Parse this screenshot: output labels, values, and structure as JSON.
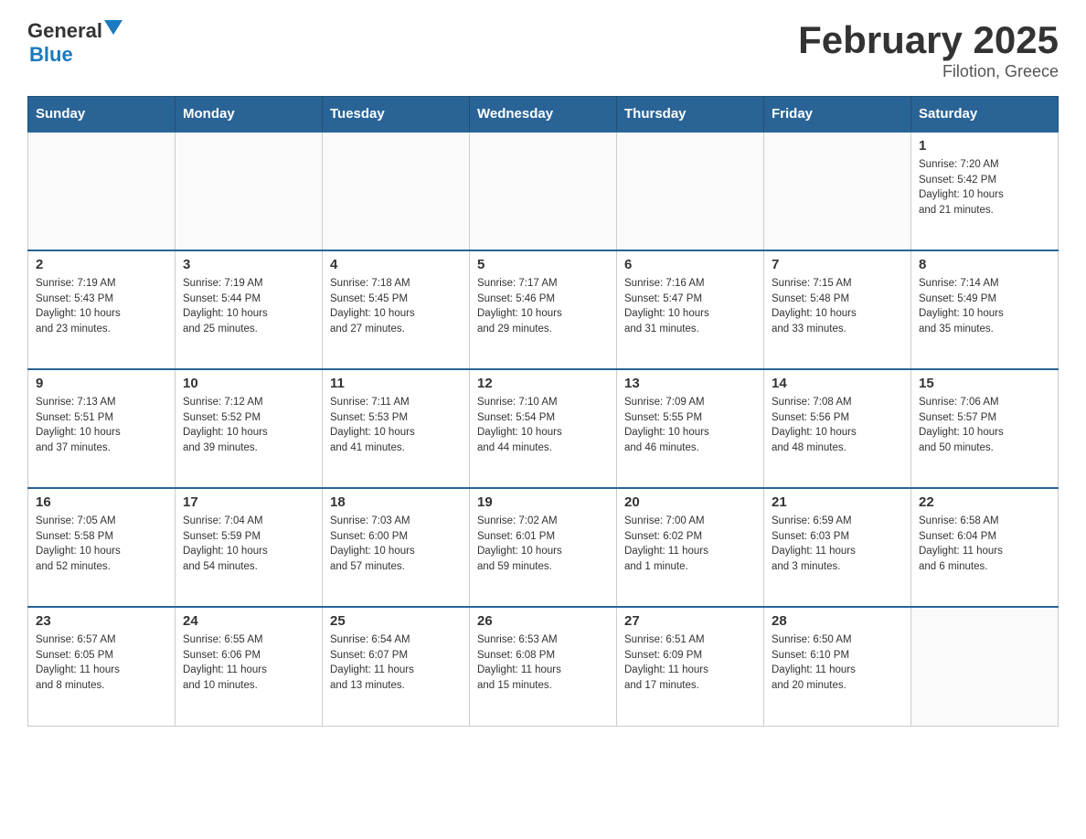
{
  "header": {
    "logo": {
      "general": "General",
      "blue": "Blue"
    },
    "title": "February 2025",
    "subtitle": "Filotion, Greece"
  },
  "calendar": {
    "headers": [
      "Sunday",
      "Monday",
      "Tuesday",
      "Wednesday",
      "Thursday",
      "Friday",
      "Saturday"
    ],
    "weeks": [
      [
        {
          "day": "",
          "info": ""
        },
        {
          "day": "",
          "info": ""
        },
        {
          "day": "",
          "info": ""
        },
        {
          "day": "",
          "info": ""
        },
        {
          "day": "",
          "info": ""
        },
        {
          "day": "",
          "info": ""
        },
        {
          "day": "1",
          "info": "Sunrise: 7:20 AM\nSunset: 5:42 PM\nDaylight: 10 hours\nand 21 minutes."
        }
      ],
      [
        {
          "day": "2",
          "info": "Sunrise: 7:19 AM\nSunset: 5:43 PM\nDaylight: 10 hours\nand 23 minutes."
        },
        {
          "day": "3",
          "info": "Sunrise: 7:19 AM\nSunset: 5:44 PM\nDaylight: 10 hours\nand 25 minutes."
        },
        {
          "day": "4",
          "info": "Sunrise: 7:18 AM\nSunset: 5:45 PM\nDaylight: 10 hours\nand 27 minutes."
        },
        {
          "day": "5",
          "info": "Sunrise: 7:17 AM\nSunset: 5:46 PM\nDaylight: 10 hours\nand 29 minutes."
        },
        {
          "day": "6",
          "info": "Sunrise: 7:16 AM\nSunset: 5:47 PM\nDaylight: 10 hours\nand 31 minutes."
        },
        {
          "day": "7",
          "info": "Sunrise: 7:15 AM\nSunset: 5:48 PM\nDaylight: 10 hours\nand 33 minutes."
        },
        {
          "day": "8",
          "info": "Sunrise: 7:14 AM\nSunset: 5:49 PM\nDaylight: 10 hours\nand 35 minutes."
        }
      ],
      [
        {
          "day": "9",
          "info": "Sunrise: 7:13 AM\nSunset: 5:51 PM\nDaylight: 10 hours\nand 37 minutes."
        },
        {
          "day": "10",
          "info": "Sunrise: 7:12 AM\nSunset: 5:52 PM\nDaylight: 10 hours\nand 39 minutes."
        },
        {
          "day": "11",
          "info": "Sunrise: 7:11 AM\nSunset: 5:53 PM\nDaylight: 10 hours\nand 41 minutes."
        },
        {
          "day": "12",
          "info": "Sunrise: 7:10 AM\nSunset: 5:54 PM\nDaylight: 10 hours\nand 44 minutes."
        },
        {
          "day": "13",
          "info": "Sunrise: 7:09 AM\nSunset: 5:55 PM\nDaylight: 10 hours\nand 46 minutes."
        },
        {
          "day": "14",
          "info": "Sunrise: 7:08 AM\nSunset: 5:56 PM\nDaylight: 10 hours\nand 48 minutes."
        },
        {
          "day": "15",
          "info": "Sunrise: 7:06 AM\nSunset: 5:57 PM\nDaylight: 10 hours\nand 50 minutes."
        }
      ],
      [
        {
          "day": "16",
          "info": "Sunrise: 7:05 AM\nSunset: 5:58 PM\nDaylight: 10 hours\nand 52 minutes."
        },
        {
          "day": "17",
          "info": "Sunrise: 7:04 AM\nSunset: 5:59 PM\nDaylight: 10 hours\nand 54 minutes."
        },
        {
          "day": "18",
          "info": "Sunrise: 7:03 AM\nSunset: 6:00 PM\nDaylight: 10 hours\nand 57 minutes."
        },
        {
          "day": "19",
          "info": "Sunrise: 7:02 AM\nSunset: 6:01 PM\nDaylight: 10 hours\nand 59 minutes."
        },
        {
          "day": "20",
          "info": "Sunrise: 7:00 AM\nSunset: 6:02 PM\nDaylight: 11 hours\nand 1 minute."
        },
        {
          "day": "21",
          "info": "Sunrise: 6:59 AM\nSunset: 6:03 PM\nDaylight: 11 hours\nand 3 minutes."
        },
        {
          "day": "22",
          "info": "Sunrise: 6:58 AM\nSunset: 6:04 PM\nDaylight: 11 hours\nand 6 minutes."
        }
      ],
      [
        {
          "day": "23",
          "info": "Sunrise: 6:57 AM\nSunset: 6:05 PM\nDaylight: 11 hours\nand 8 minutes."
        },
        {
          "day": "24",
          "info": "Sunrise: 6:55 AM\nSunset: 6:06 PM\nDaylight: 11 hours\nand 10 minutes."
        },
        {
          "day": "25",
          "info": "Sunrise: 6:54 AM\nSunset: 6:07 PM\nDaylight: 11 hours\nand 13 minutes."
        },
        {
          "day": "26",
          "info": "Sunrise: 6:53 AM\nSunset: 6:08 PM\nDaylight: 11 hours\nand 15 minutes."
        },
        {
          "day": "27",
          "info": "Sunrise: 6:51 AM\nSunset: 6:09 PM\nDaylight: 11 hours\nand 17 minutes."
        },
        {
          "day": "28",
          "info": "Sunrise: 6:50 AM\nSunset: 6:10 PM\nDaylight: 11 hours\nand 20 minutes."
        },
        {
          "day": "",
          "info": ""
        }
      ]
    ]
  }
}
